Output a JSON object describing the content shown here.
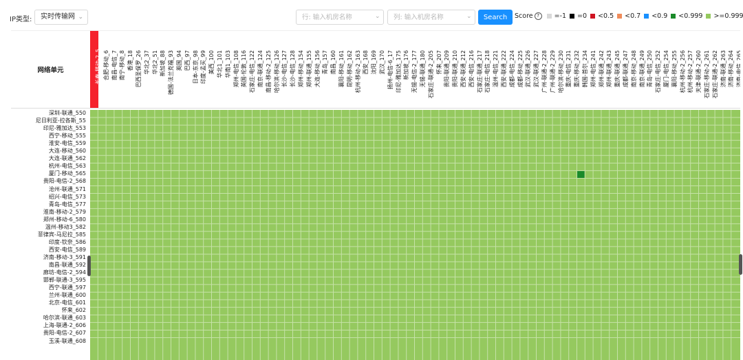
{
  "toolbar": {
    "ip_type_label": "IP类型:",
    "ip_type_value": "实时传输网",
    "row_search_placeholder": "行: 输入机房名称",
    "col_search_placeholder": "列: 输入机房名称",
    "search_label": "Search"
  },
  "legend": {
    "title": "Score",
    "help": "?",
    "items": [
      {
        "label": "=-1",
        "color": "#d9d9d9"
      },
      {
        "label": "=0",
        "color": "#000000"
      },
      {
        "label": "<0.5",
        "color": "#cf1322"
      },
      {
        "label": "<0.7",
        "color": "#f08c5a"
      },
      {
        "label": "<0.9",
        "color": "#1890ff"
      },
      {
        "label": "<0.999",
        "color": "#1a8a2a"
      },
      {
        "label": ">=0.999",
        "color": "#95c95f"
      }
    ]
  },
  "grid": {
    "corner_label": "网络单元",
    "highlight_color": "#f5222d",
    "cell_color": "#95c95f",
    "anomaly_color": "#1a8a2a",
    "columns": [
      "长春-移动-2_5",
      "合肥-移动_6",
      "南昌-电信_7",
      "南宁-移动_8",
      "香港_18",
      "巴西圣保罗_26",
      "华北2_37",
      "华北2_51",
      "新加坡_88",
      "德国-法兰克福_93",
      "英国_94",
      "巴西_97",
      "日本-东京_98",
      "印度-孟买_99",
      "美西_100",
      "华北1_101",
      "华南1_103",
      "郑州-电信_108",
      "英国-伦敦_116",
      "石家庄-电信_122",
      "南京-联通_124",
      "南昌-移动-2_125",
      "哈尔滨-移动_126",
      "长沙-电信_127",
      "长沙-电信_128",
      "郑州-移动_154",
      "郑州-联通_155",
      "大连-移动_156",
      "青岛_157",
      "南昌_160",
      "襄阳-移动_161",
      "昆明-移动_162",
      "杭州-移动-2_163",
      "西安_168",
      "沈阳_169",
      "武汉_170",
      "扬州-电信-6_17",
      "印尼-雅加达_175",
      "新加坡_176",
      "无锡-电信-2_177",
      "无锡-联通_180",
      "石家庄-联通-2_205",
      "怀来_207",
      "贵阳-联通_209",
      "贵阳-联通_210",
      "西安-联通_212",
      "西安-电信_216",
      "石家庄-联通_217",
      "石家庄-电信_218",
      "温州-电信_221",
      "西安-联通_222",
      "成都-电信_224",
      "成都-移动_225",
      "武汉-联通_226",
      "武汉-联通_227",
      "广州-联通-2_228",
      "广州-联通-2_229",
      "哈尔滨-移动_230",
      "重庆-电信_231",
      "重庆-移动_232",
      "韩国-首尔_234",
      "郑州-电信_241",
      "郑州-联通_242",
      "郑州-联通_243",
      "重庆-联通_245",
      "成都-联通_247",
      "南京-移动_248",
      "南京-联通_249",
      "青岛-电信_250",
      "石家庄-电信_252",
      "厦门-电信_254",
      "襄阳-移动_255",
      "杭州-移动-2_256",
      "杭州-移动-2_257",
      "天津-联通-2_260",
      "石家庄-移动-2_261",
      "石家庄-联通-2_262",
      "济南-联通_263",
      "济南-移动_264",
      "济南-电信_265"
    ],
    "rows": [
      "深圳-联通_550",
      "尼日利亚-拉各斯_55",
      "印尼-雅加达_553",
      "西宁-移动_555",
      "淮安-电信_559",
      "大连-移动_560",
      "大连-联通_562",
      "杭州-电信_563",
      "厦门-移动_565",
      "贵阳-电信-2_568",
      "沧州-联通_571",
      "绍兴-电信_573",
      "青岛-电信_577",
      "淮南-移动-2_579",
      "郑州-移动-6_580",
      "温州-移动3_582",
      "菲律宾-马尼拉_585",
      "印度-钦奈_586",
      "西安-电信_589",
      "济南-移动-3_591",
      "南昌-联通_592",
      "廊坊-电信-2_594",
      "邯郸-联通-3_595",
      "西宁-联通_597",
      "兰州-联通_600",
      "北京-电信_601",
      "怀来_602",
      "哈尔滨-联通_603",
      "上海-联通-2_606",
      "贵阳-电信-2_607",
      "玉溪-联通_608"
    ],
    "anomaly": {
      "row_index": 8,
      "col_index": 60,
      "score_band": "<0.999"
    }
  }
}
